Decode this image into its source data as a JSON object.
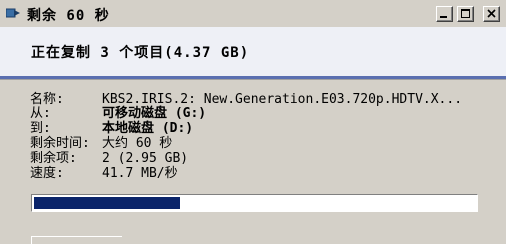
{
  "window": {
    "title": "剩余 60 秒",
    "minimize_label": "—",
    "maximize_label": "□",
    "close_label": "✕",
    "title_icon": "copy-files-icon"
  },
  "header": {
    "text": "正在复制 3 个项目(4.37 GB)"
  },
  "details": [
    {
      "label": "名称:",
      "value": "KBS2.IRIS.2: New.Generation.E03.720p.HDTV.X..."
    },
    {
      "label": "从:",
      "value": "可移动磁盘 (G:)"
    },
    {
      "label": "到:",
      "value": "本地磁盘 (D:)"
    },
    {
      "label": "剩余时间:",
      "value": "大约 60 秒"
    },
    {
      "label": "剩余项:",
      "value": "2 (2.95 GB)"
    },
    {
      "label": "速度:",
      "value": "41.7 MB/秒"
    }
  ],
  "progress": {
    "fraction": 0.33,
    "color": "#0a246a"
  },
  "colors": {
    "header_background": "#eef0f6",
    "accent_rule": "#5a6fb0",
    "window_face": "#d4d0c8"
  }
}
